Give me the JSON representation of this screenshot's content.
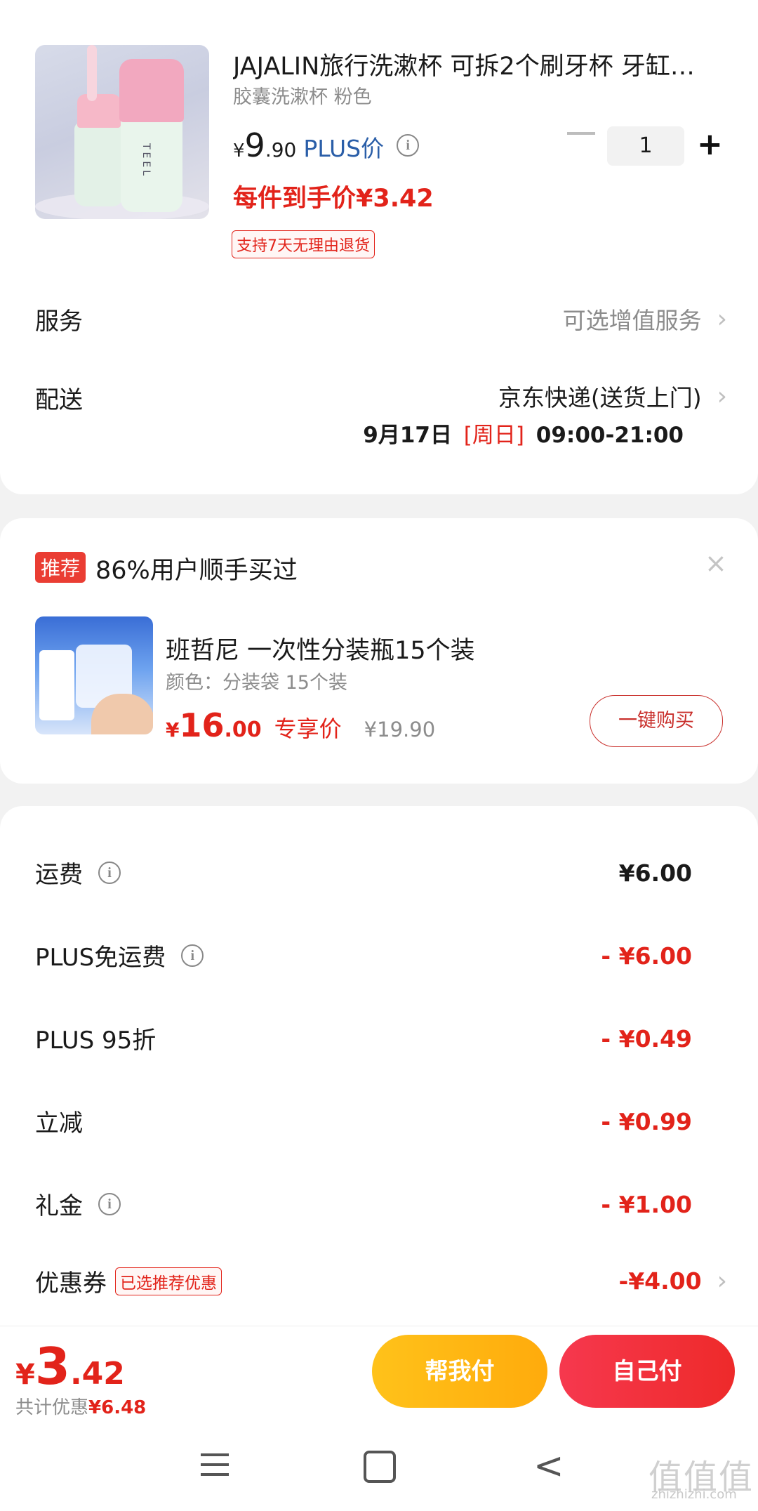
{
  "product": {
    "title": "JAJALIN旅行洗漱杯 可拆2个刷牙杯 牙缸…",
    "variant": "胶囊洗漱杯 粉色",
    "image_text": "TEEL",
    "price_symbol": "¥",
    "price_int": "9",
    "price_dec": ".90",
    "price_label": "PLUS价",
    "quantity": "1",
    "final_price_text": "每件到手价¥3.42",
    "return_badge": "支持7天无理由退货"
  },
  "service": {
    "label": "服务",
    "value": "可选增值服务"
  },
  "delivery": {
    "label": "配送",
    "method": "京东快递(送货上门)",
    "date": "9月17日",
    "weekday": "[周日]",
    "time": "09:00-21:00"
  },
  "recommend": {
    "tag": "推荐",
    "title": "86%用户顺手买过",
    "item": {
      "name": "班哲尼 一次性分装瓶15个装",
      "spec": "颜色：分装袋 15个装",
      "price_symbol": "¥",
      "price_int": "16",
      "price_dec": ".00",
      "price_label": "专享价",
      "orig_price": "¥19.90",
      "buy_label": "一键购买"
    }
  },
  "fees": [
    {
      "label": "运费",
      "info": true,
      "value": "¥6.00",
      "color": "black"
    },
    {
      "label": "PLUS免运费",
      "info": true,
      "value": "- ¥6.00",
      "color": "red"
    },
    {
      "label": "PLUS 95折",
      "info": false,
      "value": "- ¥0.49",
      "color": "red"
    },
    {
      "label": "立减",
      "info": false,
      "value": "- ¥0.99",
      "color": "red"
    },
    {
      "label": "礼金",
      "info": true,
      "value": "- ¥1.00",
      "color": "red"
    },
    {
      "label": "优惠券",
      "badge": "已选推荐优惠",
      "value": "-¥4.00",
      "color": "red",
      "chevron": true
    }
  ],
  "total": {
    "symbol": "¥",
    "int": "3",
    "dec": ".42",
    "saved_label": "共计优惠",
    "saved_value": "¥6.48"
  },
  "buttons": {
    "help_pay": "帮我付",
    "self_pay": "自己付"
  },
  "watermark": {
    "brand": "值值值",
    "url": "zhizhizhi.com"
  },
  "icons": {
    "info": "i",
    "chevron": "›",
    "close": "×",
    "plus": "+",
    "back": "<"
  },
  "colors": {
    "accent_red": "#e2231a",
    "plus_blue": "#2a5ea8",
    "help_btn": "#ffb712",
    "self_btn": "#f13040"
  }
}
